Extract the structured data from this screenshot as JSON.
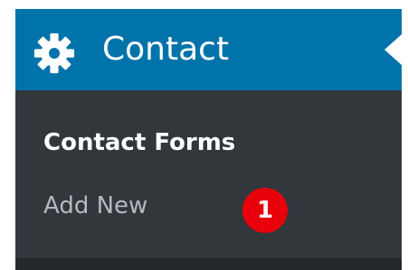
{
  "menu": {
    "title": "Contact",
    "icon": "gear-icon",
    "header_color": "#0073aa",
    "submenu": [
      {
        "label": "Contact Forms",
        "current": true
      },
      {
        "label": "Add New",
        "current": false
      }
    ]
  },
  "annotation": {
    "badge_text": "1",
    "badge_color": "#e8000b"
  }
}
